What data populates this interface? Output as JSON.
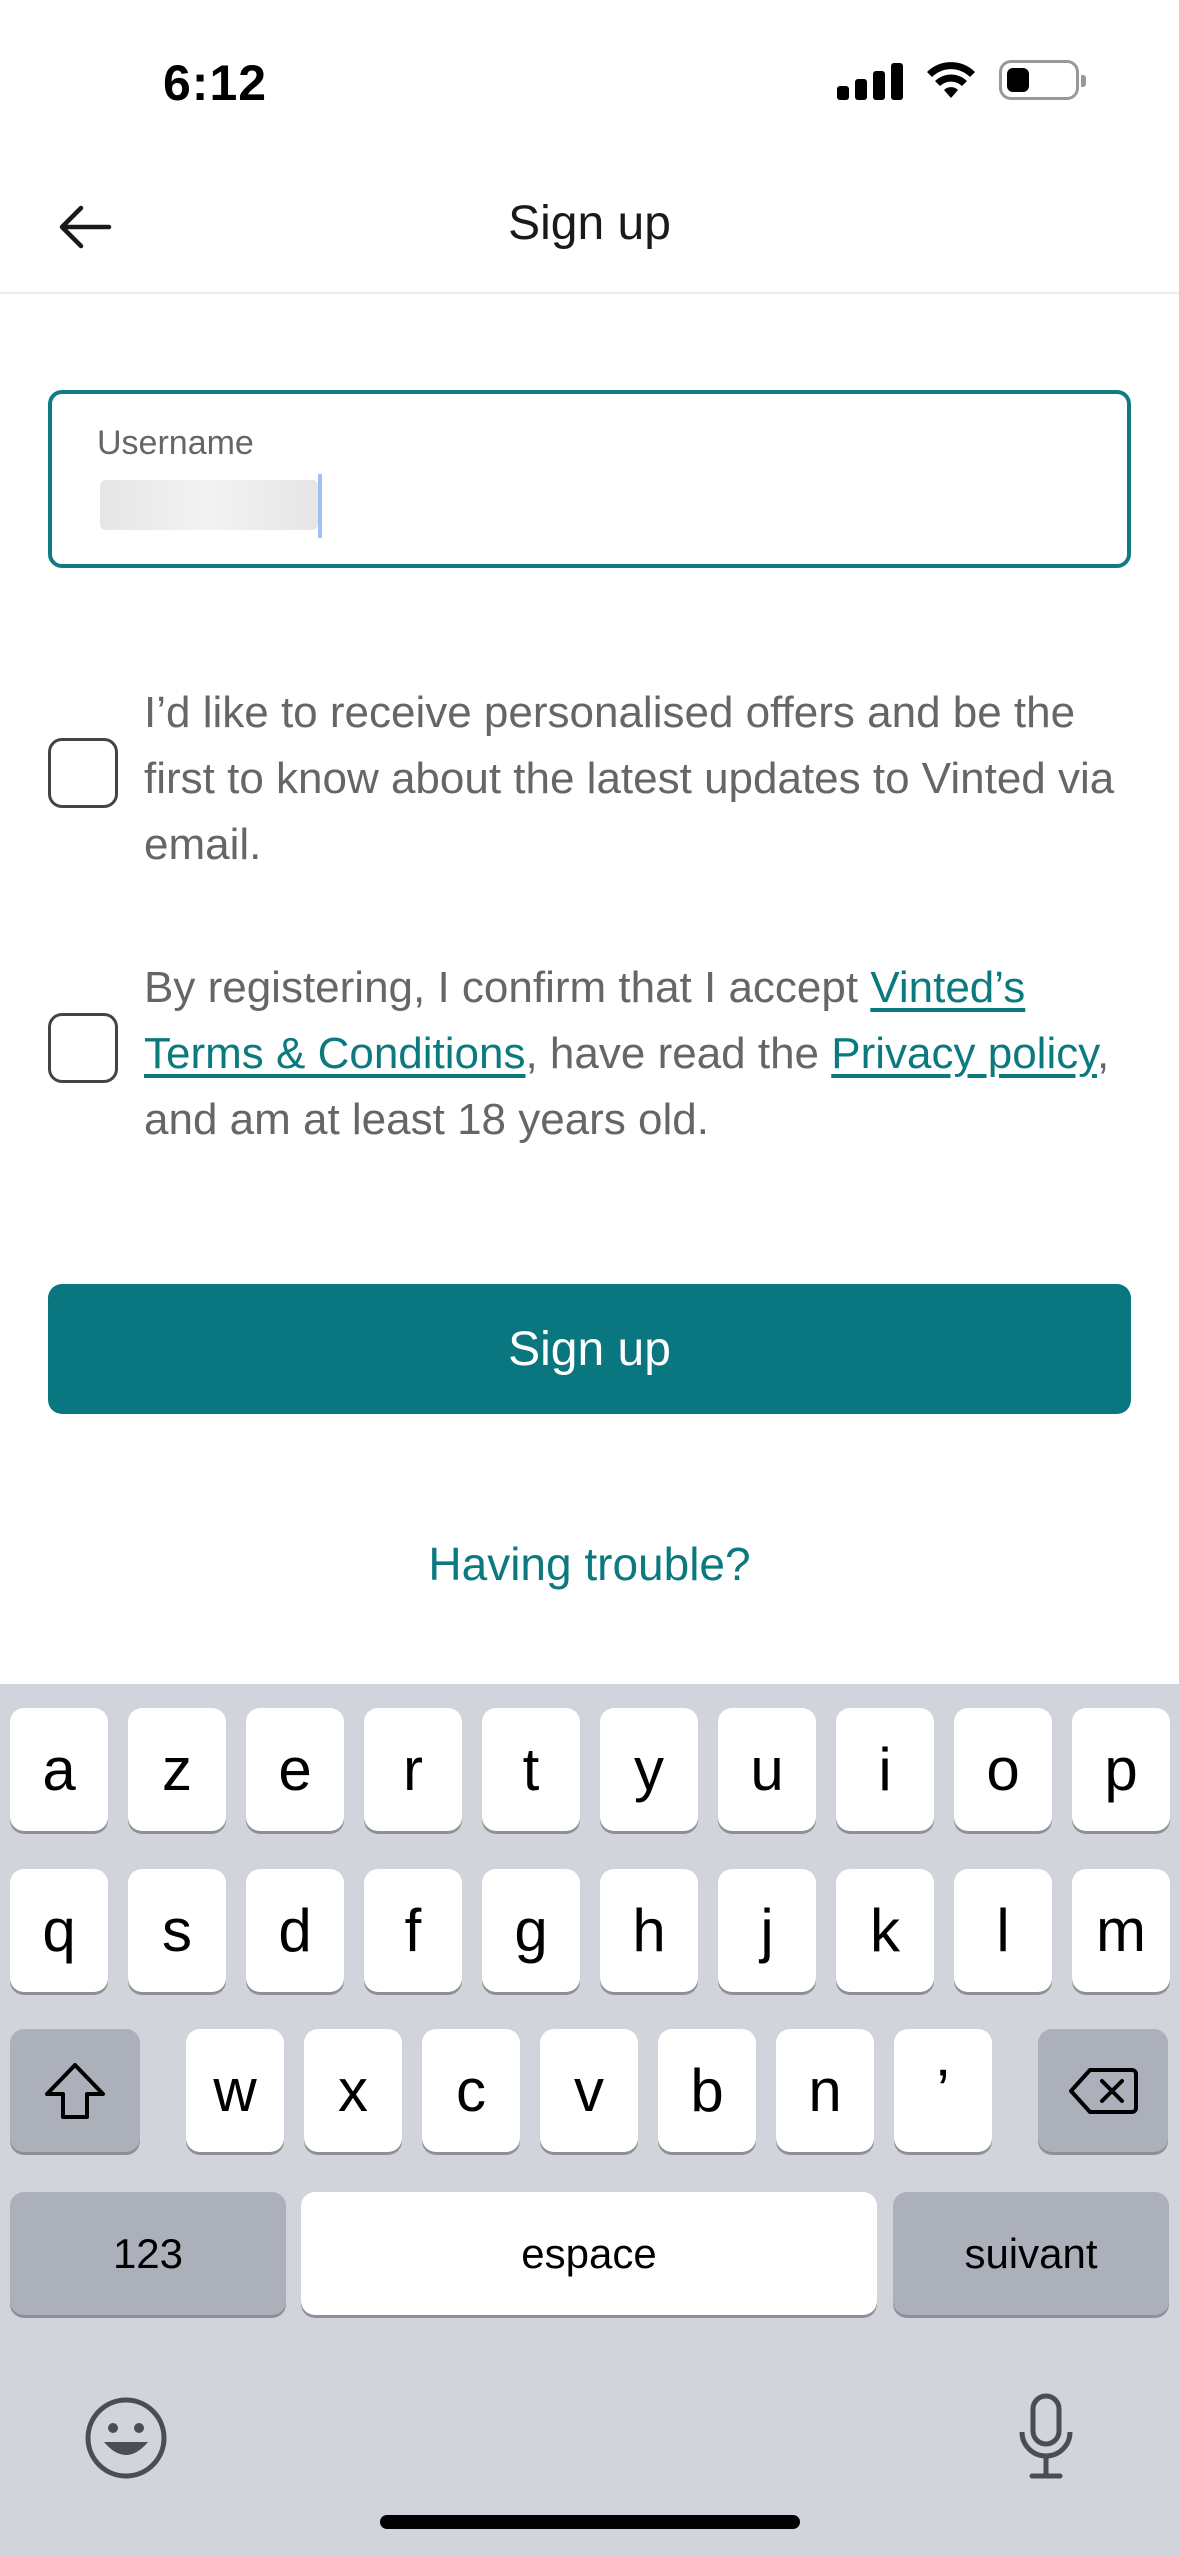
{
  "status_bar": {
    "time": "6:12"
  },
  "nav": {
    "title": "Sign up"
  },
  "username": {
    "label": "Username"
  },
  "consents": {
    "marketing_text": "I’d like to receive personalised offers and be the first to know about the latest updates to Vinted via email.",
    "terms_prefix": "By registering, I confirm that I accept ",
    "terms_link": "Vinted’s Terms & Conditions",
    "terms_middle": ", have read the ",
    "privacy_link": "Privacy policy",
    "terms_suffix": ", and am at least 18 years old."
  },
  "actions": {
    "signup_label": "Sign up",
    "trouble_label": "Having trouble?"
  },
  "keyboard": {
    "row1": [
      "a",
      "z",
      "e",
      "r",
      "t",
      "y",
      "u",
      "i",
      "o",
      "p"
    ],
    "row2": [
      "q",
      "s",
      "d",
      "f",
      "g",
      "h",
      "j",
      "k",
      "l",
      "m"
    ],
    "row3": [
      "w",
      "x",
      "c",
      "v",
      "b",
      "n",
      "’"
    ],
    "numbers_label": "123",
    "space_label": "espace",
    "return_label": "suivant"
  },
  "colors": {
    "accent": "#0a7780",
    "keyboard_bg": "#d1d4db"
  }
}
